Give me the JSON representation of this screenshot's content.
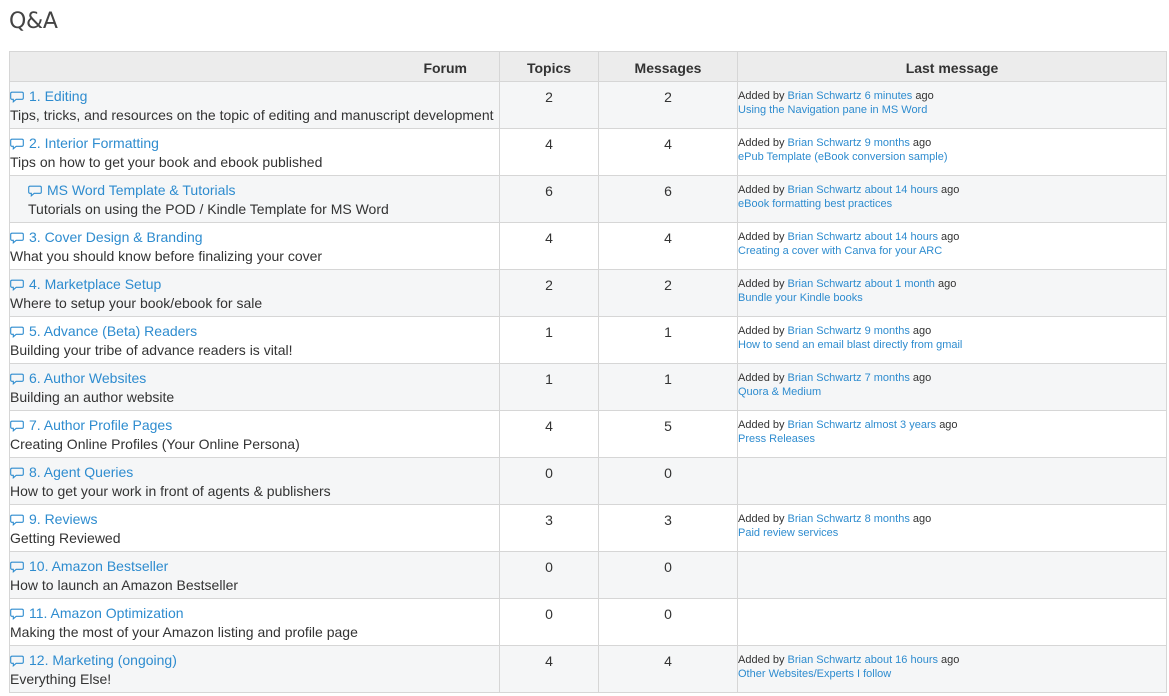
{
  "page": {
    "title": "Q&A"
  },
  "table": {
    "headers": {
      "forum": "Forum",
      "topics": "Topics",
      "messages": "Messages",
      "last": "Last message"
    }
  },
  "forums": [
    {
      "title": "1. Editing",
      "desc": "Tips, tricks, and resources on the topic of editing and manuscript development",
      "topics": "2",
      "messages": "2",
      "last": {
        "prefix": "Added by",
        "author": "Brian Schwartz",
        "time": "6 minutes",
        "suffix": "ago",
        "topic": "Using the Navigation pane in MS Word"
      }
    },
    {
      "title": "2. Interior Formatting",
      "desc": "Tips on how to get your book and ebook published",
      "topics": "4",
      "messages": "4",
      "last": {
        "prefix": "Added by",
        "author": "Brian Schwartz",
        "time": "9 months",
        "suffix": "ago",
        "topic": "ePub Template (eBook conversion sample)"
      }
    },
    {
      "title": "MS Word Template & Tutorials",
      "desc": "Tutorials on using the POD / Kindle Template for MS Word",
      "topics": "6",
      "messages": "6",
      "sub": true,
      "last": {
        "prefix": "Added by",
        "author": "Brian Schwartz",
        "time": "about 14 hours",
        "suffix": "ago",
        "topic": "eBook formatting best practices"
      }
    },
    {
      "title": "3. Cover Design & Branding",
      "desc": "What you should know before finalizing your cover",
      "topics": "4",
      "messages": "4",
      "last": {
        "prefix": "Added by",
        "author": "Brian Schwartz",
        "time": "about 14 hours",
        "suffix": "ago",
        "topic": "Creating a cover with Canva for your ARC"
      }
    },
    {
      "title": "4. Marketplace Setup",
      "desc": "Where to setup your book/ebook for sale",
      "topics": "2",
      "messages": "2",
      "last": {
        "prefix": "Added by",
        "author": "Brian Schwartz",
        "time": "about 1 month",
        "suffix": "ago",
        "topic": "Bundle your Kindle books"
      }
    },
    {
      "title": "5. Advance (Beta) Readers",
      "desc": "Building your tribe of advance readers is vital!",
      "topics": "1",
      "messages": "1",
      "last": {
        "prefix": "Added by",
        "author": "Brian Schwartz",
        "time": "9 months",
        "suffix": "ago",
        "topic": "How to send an email blast directly from gmail"
      }
    },
    {
      "title": "6. Author Websites",
      "desc": "Building an author website",
      "topics": "1",
      "messages": "1",
      "last": {
        "prefix": "Added by",
        "author": "Brian Schwartz",
        "time": "7 months",
        "suffix": "ago",
        "topic": "Quora & Medium"
      }
    },
    {
      "title": "7. Author Profile Pages",
      "desc": "Creating Online Profiles (Your Online Persona)",
      "topics": "4",
      "messages": "5",
      "last": {
        "prefix": "Added by",
        "author": "Brian Schwartz",
        "time": "almost 3 years",
        "suffix": "ago",
        "topic": "Press Releases"
      }
    },
    {
      "title": "8. Agent Queries",
      "desc": "How to get your work in front of agents & publishers",
      "topics": "0",
      "messages": "0",
      "last": null
    },
    {
      "title": "9. Reviews",
      "desc": "Getting Reviewed",
      "topics": "3",
      "messages": "3",
      "last": {
        "prefix": "Added by",
        "author": "Brian Schwartz",
        "time": "8 months",
        "suffix": "ago",
        "topic": "Paid review services"
      }
    },
    {
      "title": "10. Amazon Bestseller",
      "desc": "How to launch an Amazon Bestseller",
      "topics": "0",
      "messages": "0",
      "last": null
    },
    {
      "title": "11. Amazon Optimization",
      "desc": "Making the most of your Amazon listing and profile page",
      "topics": "0",
      "messages": "0",
      "last": null
    },
    {
      "title": "12. Marketing (ongoing)",
      "desc": "Everything Else!",
      "topics": "4",
      "messages": "4",
      "last": {
        "prefix": "Added by",
        "author": "Brian Schwartz",
        "time": "about 16 hours",
        "suffix": "ago",
        "topic": "Other Websites/Experts I follow"
      }
    }
  ],
  "colors": {
    "link": "#2e8ccf",
    "text": "#333333",
    "header_bg": "#ececec",
    "row_alt_bg": "#f5f6f7",
    "border": "#d6d6d6"
  },
  "icons": {
    "forum": "speech-bubble-icon"
  }
}
